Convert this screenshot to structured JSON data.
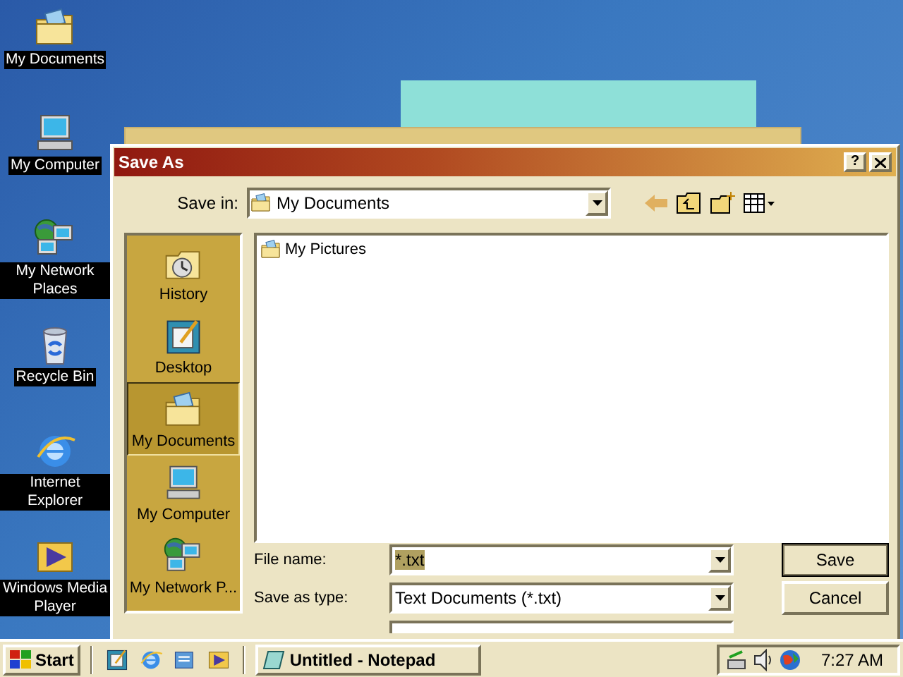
{
  "desktop_icons": [
    {
      "label": "My Documents",
      "kind": "documents"
    },
    {
      "label": "My Computer",
      "kind": "computer"
    },
    {
      "label": "My Network Places",
      "kind": "network"
    },
    {
      "label": "Recycle Bin",
      "kind": "recycle"
    },
    {
      "label": "Internet Explorer",
      "kind": "browser"
    },
    {
      "label": "Windows Media Player",
      "kind": "media"
    }
  ],
  "dialog": {
    "title": "Save As",
    "help_glyph": "?",
    "save_in": {
      "label": "Save in:",
      "value": "My Documents"
    },
    "places": [
      {
        "label": "History",
        "kind": "history",
        "selected": false
      },
      {
        "label": "Desktop",
        "kind": "desktop",
        "selected": false
      },
      {
        "label": "My Documents",
        "kind": "documents",
        "selected": true
      },
      {
        "label": "My Computer",
        "kind": "computer",
        "selected": false
      },
      {
        "label": "My Network P...",
        "kind": "network",
        "selected": false
      }
    ],
    "files": [
      {
        "name": "My Pictures"
      }
    ],
    "file_name": {
      "label": "File name:",
      "value": "*.txt"
    },
    "save_as_type": {
      "label": "Save as type:",
      "value": "Text Documents (*.txt)"
    },
    "buttons": [
      "Save",
      "Cancel"
    ]
  },
  "taskbar": {
    "start": "Start",
    "quick_launch": [
      {
        "kind": "desktop"
      },
      {
        "kind": "browser"
      },
      {
        "kind": "outlook"
      },
      {
        "kind": "media"
      }
    ],
    "tasks": [
      {
        "label": "Untitled - Notepad",
        "selected": false
      }
    ],
    "clock": "7:27 AM"
  }
}
